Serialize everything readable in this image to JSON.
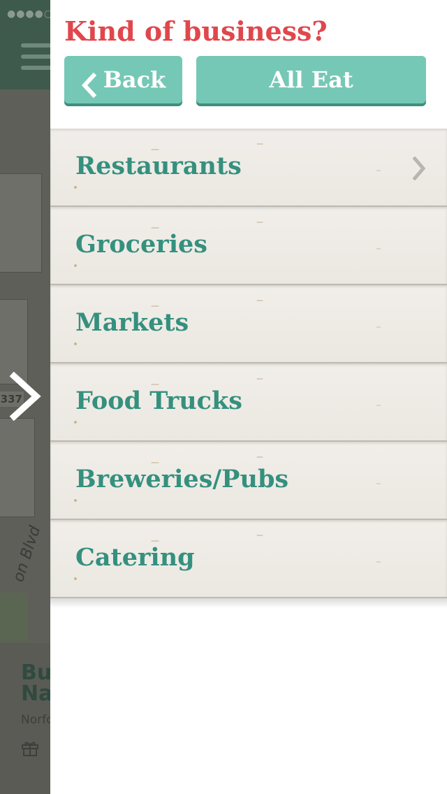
{
  "statusbar": {
    "signal_dots": "●●●●○"
  },
  "drawer": {
    "title": "Kind of business?",
    "back_label": "Back",
    "all_label": "All Eat",
    "categories": [
      {
        "label": "Restaurants",
        "has_submenu": true
      },
      {
        "label": "Groceries",
        "has_submenu": false
      },
      {
        "label": "Markets",
        "has_submenu": false
      },
      {
        "label": "Food Trucks",
        "has_submenu": false
      },
      {
        "label": "Breweries/Pubs",
        "has_submenu": false
      },
      {
        "label": "Catering",
        "has_submenu": false
      }
    ]
  },
  "background": {
    "map_route_label": "337",
    "map_street_label": "on Blvd",
    "business_name": "Bu Na",
    "business_city": "Norfo"
  },
  "colors": {
    "title": "#e0474c",
    "button": "#76c8b6",
    "category_text": "#35907e",
    "row_background": "#efece6"
  },
  "icons": {
    "back": "chevron-left-icon",
    "submenu": "chevron-right-icon",
    "open_panel": "chevron-right-icon",
    "menu": "hamburger-icon",
    "gift": "gift-icon"
  }
}
